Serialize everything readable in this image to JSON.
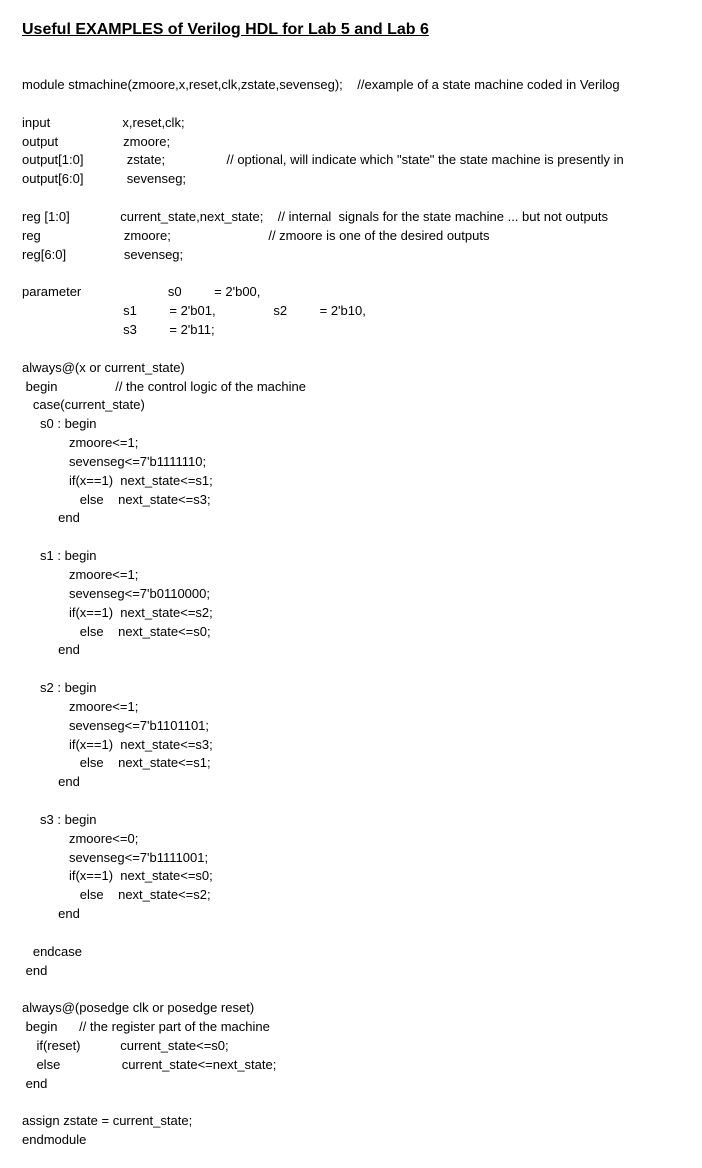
{
  "title": "Useful EXAMPLES of Verilog HDL for Lab 5 and Lab 6",
  "code": {
    "line_module": "module stmachine(zmoore,x,reset,clk,zstate,sevenseg);    //example of a state machine coded in Verilog",
    "decl_input": "input                    x,reset,clk;",
    "decl_output": "output                  zmoore;",
    "decl_zstate": "output[1:0]            zstate;                 // optional, will indicate which \"state\" the state machine is presently in",
    "decl_sevenseg": "output[6:0]            sevenseg;",
    "reg_cs": "reg [1:0]              current_state,next_state;    // internal  signals for the state machine ... but not outputs",
    "reg_zm": "reg                       zmoore;                           // zmoore is one of the desired outputs",
    "reg_ss": "reg[6:0]                sevenseg;",
    "param_line1": "parameter                        s0         = 2'b00,",
    "param_line2": "                            s1         = 2'b01,                s2         = 2'b10,",
    "param_line3": "                            s3         = 2'b11;",
    "always1": "always@(x or current_state)",
    "begin1": " begin                // the control logic of the machine",
    "case_open": "   case(current_state)",
    "s0": {
      "head": "     s0 : begin",
      "l1": "             zmoore<=1;",
      "l2": "             sevenseg<=7'b1111110;",
      "l3": "             if(x==1)  next_state<=s1;",
      "l4": "                else    next_state<=s3;",
      "end": "          end"
    },
    "s1": {
      "head": "     s1 : begin",
      "l1": "             zmoore<=1;",
      "l2": "             sevenseg<=7'b0110000;",
      "l3": "             if(x==1)  next_state<=s2;",
      "l4": "                else    next_state<=s0;",
      "end": "          end"
    },
    "s2": {
      "head": "     s2 : begin",
      "l1": "             zmoore<=1;",
      "l2": "             sevenseg<=7'b1101101;",
      "l3": "             if(x==1)  next_state<=s3;",
      "l4": "                else    next_state<=s1;",
      "end": "          end"
    },
    "s3": {
      "head": "     s3 : begin",
      "l1": "             zmoore<=0;",
      "l2": "             sevenseg<=7'b1111001;",
      "l3": "             if(x==1)  next_state<=s0;",
      "l4": "                else    next_state<=s2;",
      "end": "          end"
    },
    "endcase": "   endcase",
    "end1": " end",
    "always2": "always@(posedge clk or posedge reset)",
    "begin2": " begin      // the register part of the machine",
    "reset1": "    if(reset)           current_state<=s0;",
    "reset2": "    else                 current_state<=next_state;",
    "end2": " end",
    "assign": "assign zstate = current_state;",
    "endmodule": "endmodule"
  }
}
